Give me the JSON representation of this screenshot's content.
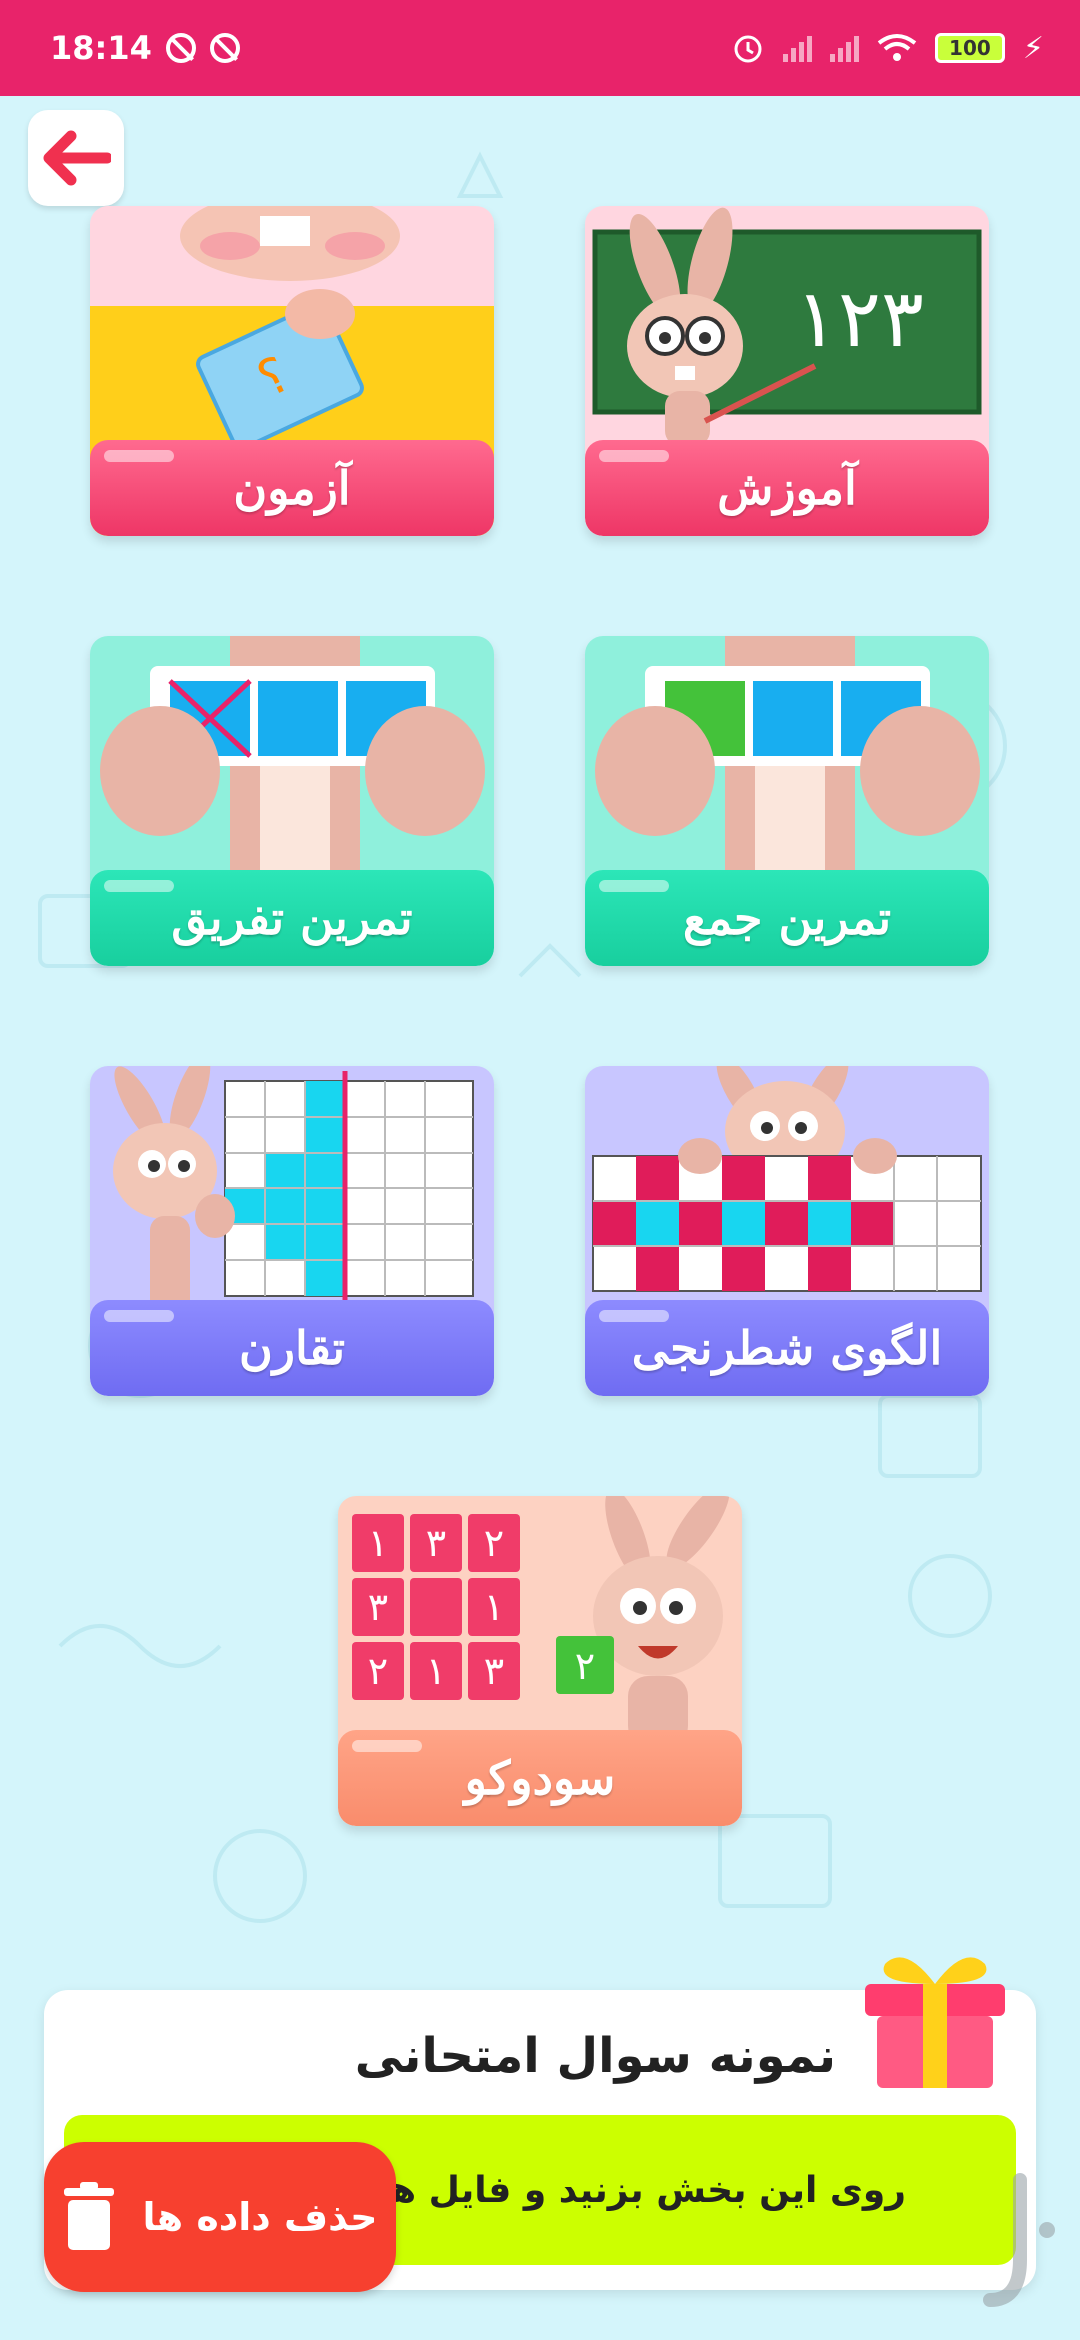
{
  "status_bar": {
    "time": "18:14",
    "battery": "100"
  },
  "cards": {
    "exam": "آزمون",
    "learning": "آموزش",
    "subtraction": "تمرین تفریق",
    "addition": "تمرین جمع",
    "symmetry": "تقارن",
    "checker_pattern": "الگوی شطرنجی",
    "sudoku": "سودوکو"
  },
  "learning_board_numbers": "۱۲۳",
  "sudoku_grid": [
    "۱",
    "۳",
    "۲",
    "۳",
    "",
    "۱",
    "۲",
    "۱",
    "۳"
  ],
  "sudoku_hint": "۲",
  "panel": {
    "title": "نمونه سوال امتحانی",
    "description": "روی این بخش بزنید و فایل ها"
  },
  "delete_button": "حذف داده ها",
  "colors": {
    "status_bar": "#e8236a",
    "background": "#d4f5fb",
    "back_arrow": "#f0304f",
    "delete": "#f7402f",
    "panel_bar": "#ccff00"
  }
}
